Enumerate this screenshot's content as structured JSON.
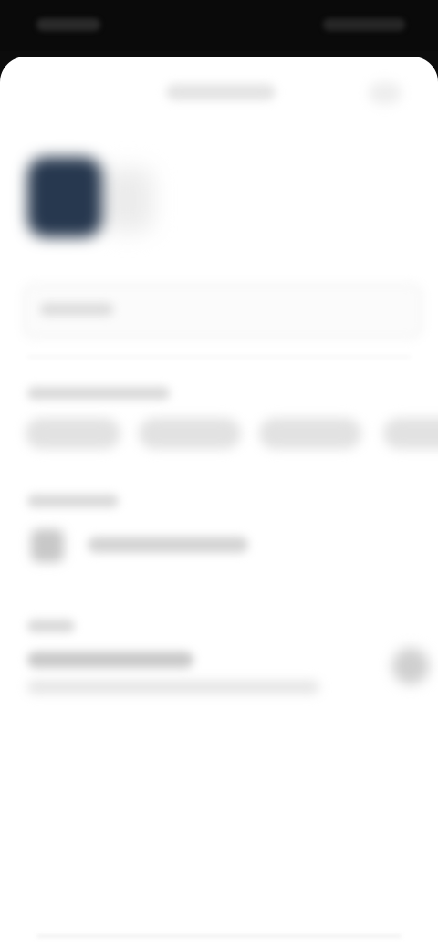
{
  "status_bar": {
    "time": "",
    "indicators": ""
  },
  "sheet": {
    "title": "",
    "action_label": ""
  },
  "name_field": {
    "label": "",
    "value": ""
  },
  "color_section": {
    "label": "",
    "chips": [
      "",
      "",
      "",
      ""
    ]
  },
  "layout_section": {
    "label": "",
    "option_text": ""
  },
  "more_section": {
    "label": "",
    "toggle_title": "",
    "toggle_subtitle": ""
  },
  "colors": {
    "app_icon": "#27384f",
    "background": "#ffffff",
    "status_bar": "#0a0a0a"
  }
}
